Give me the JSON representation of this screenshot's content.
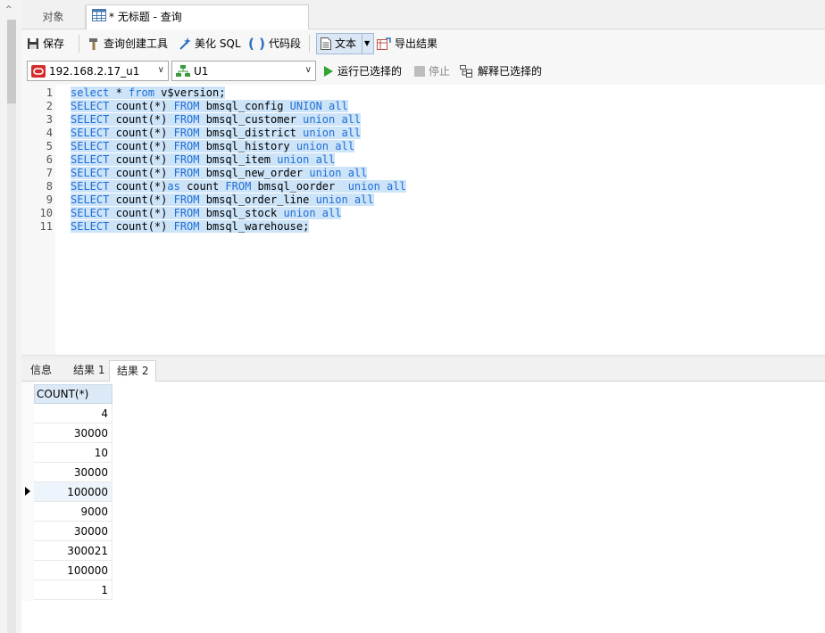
{
  "tabs": {
    "objects": "对象",
    "query": "* 无标题 - 查询"
  },
  "toolbar": {
    "save": "保存",
    "query_builder": "查询创建工具",
    "beautify": "美化 SQL",
    "snippet": "代码段",
    "text": "文本",
    "export": "导出结果"
  },
  "connection": {
    "server": "192.168.2.17_u1",
    "schema": "U1",
    "run_selected": "运行已选择的",
    "stop": "停止",
    "explain_selected": "解释已选择的"
  },
  "editor": {
    "lines": [
      [
        [
          "kw",
          "select"
        ],
        [
          "tx",
          " * "
        ],
        [
          "kw",
          "from"
        ],
        [
          "tx",
          " v$version;"
        ]
      ],
      [
        [
          "kw",
          "SELECT"
        ],
        [
          "tx",
          " count(*) "
        ],
        [
          "kw",
          "FROM"
        ],
        [
          "tx",
          " bmsql_config "
        ],
        [
          "kw",
          "UNION all"
        ]
      ],
      [
        [
          "kw",
          "SELECT"
        ],
        [
          "tx",
          " count(*) "
        ],
        [
          "kw",
          "FROM"
        ],
        [
          "tx",
          " bmsql_customer "
        ],
        [
          "kw",
          "union all"
        ]
      ],
      [
        [
          "kw",
          "SELECT"
        ],
        [
          "tx",
          " count(*) "
        ],
        [
          "kw",
          "FROM"
        ],
        [
          "tx",
          " bmsql_district "
        ],
        [
          "kw",
          "union all"
        ]
      ],
      [
        [
          "kw",
          "SELECT"
        ],
        [
          "tx",
          " count(*) "
        ],
        [
          "kw",
          "FROM"
        ],
        [
          "tx",
          " bmsql_history "
        ],
        [
          "kw",
          "union all"
        ]
      ],
      [
        [
          "kw",
          "SELECT"
        ],
        [
          "tx",
          " count(*) "
        ],
        [
          "kw",
          "FROM"
        ],
        [
          "tx",
          " bmsql_item "
        ],
        [
          "kw",
          "union all"
        ]
      ],
      [
        [
          "kw",
          "SELECT"
        ],
        [
          "tx",
          " count(*) "
        ],
        [
          "kw",
          "FROM"
        ],
        [
          "tx",
          " bmsql_new_order "
        ],
        [
          "kw",
          "union all"
        ]
      ],
      [
        [
          "kw",
          "SELECT"
        ],
        [
          "tx",
          " count(*)"
        ],
        [
          "kw",
          "as"
        ],
        [
          "tx",
          " count "
        ],
        [
          "kw",
          "FROM"
        ],
        [
          "tx",
          " bmsql_oorder  "
        ],
        [
          "kw",
          "union all"
        ]
      ],
      [
        [
          "kw",
          "SELECT"
        ],
        [
          "tx",
          " count(*) "
        ],
        [
          "kw",
          "FROM"
        ],
        [
          "tx",
          " bmsql_order_line "
        ],
        [
          "kw",
          "union all"
        ]
      ],
      [
        [
          "kw",
          "SELECT"
        ],
        [
          "tx",
          " count(*) "
        ],
        [
          "kw",
          "FROM"
        ],
        [
          "tx",
          " bmsql_stock "
        ],
        [
          "kw",
          "union all"
        ]
      ],
      [
        [
          "kw",
          "SELECT"
        ],
        [
          "tx",
          " count(*) "
        ],
        [
          "kw",
          "FROM"
        ],
        [
          "tx",
          " bmsql_warehouse;"
        ]
      ]
    ]
  },
  "result_tabs": [
    "信息",
    "结果 1",
    "结果 2"
  ],
  "result": {
    "column": "COUNT(*)",
    "rows": [
      "4",
      "30000",
      "10",
      "30000",
      "100000",
      "9000",
      "30000",
      "300021",
      "100000",
      "1"
    ]
  },
  "colors": {
    "keyword": "#1f6fd6",
    "selection": "#cce3f8",
    "header": "#dce9f6"
  }
}
